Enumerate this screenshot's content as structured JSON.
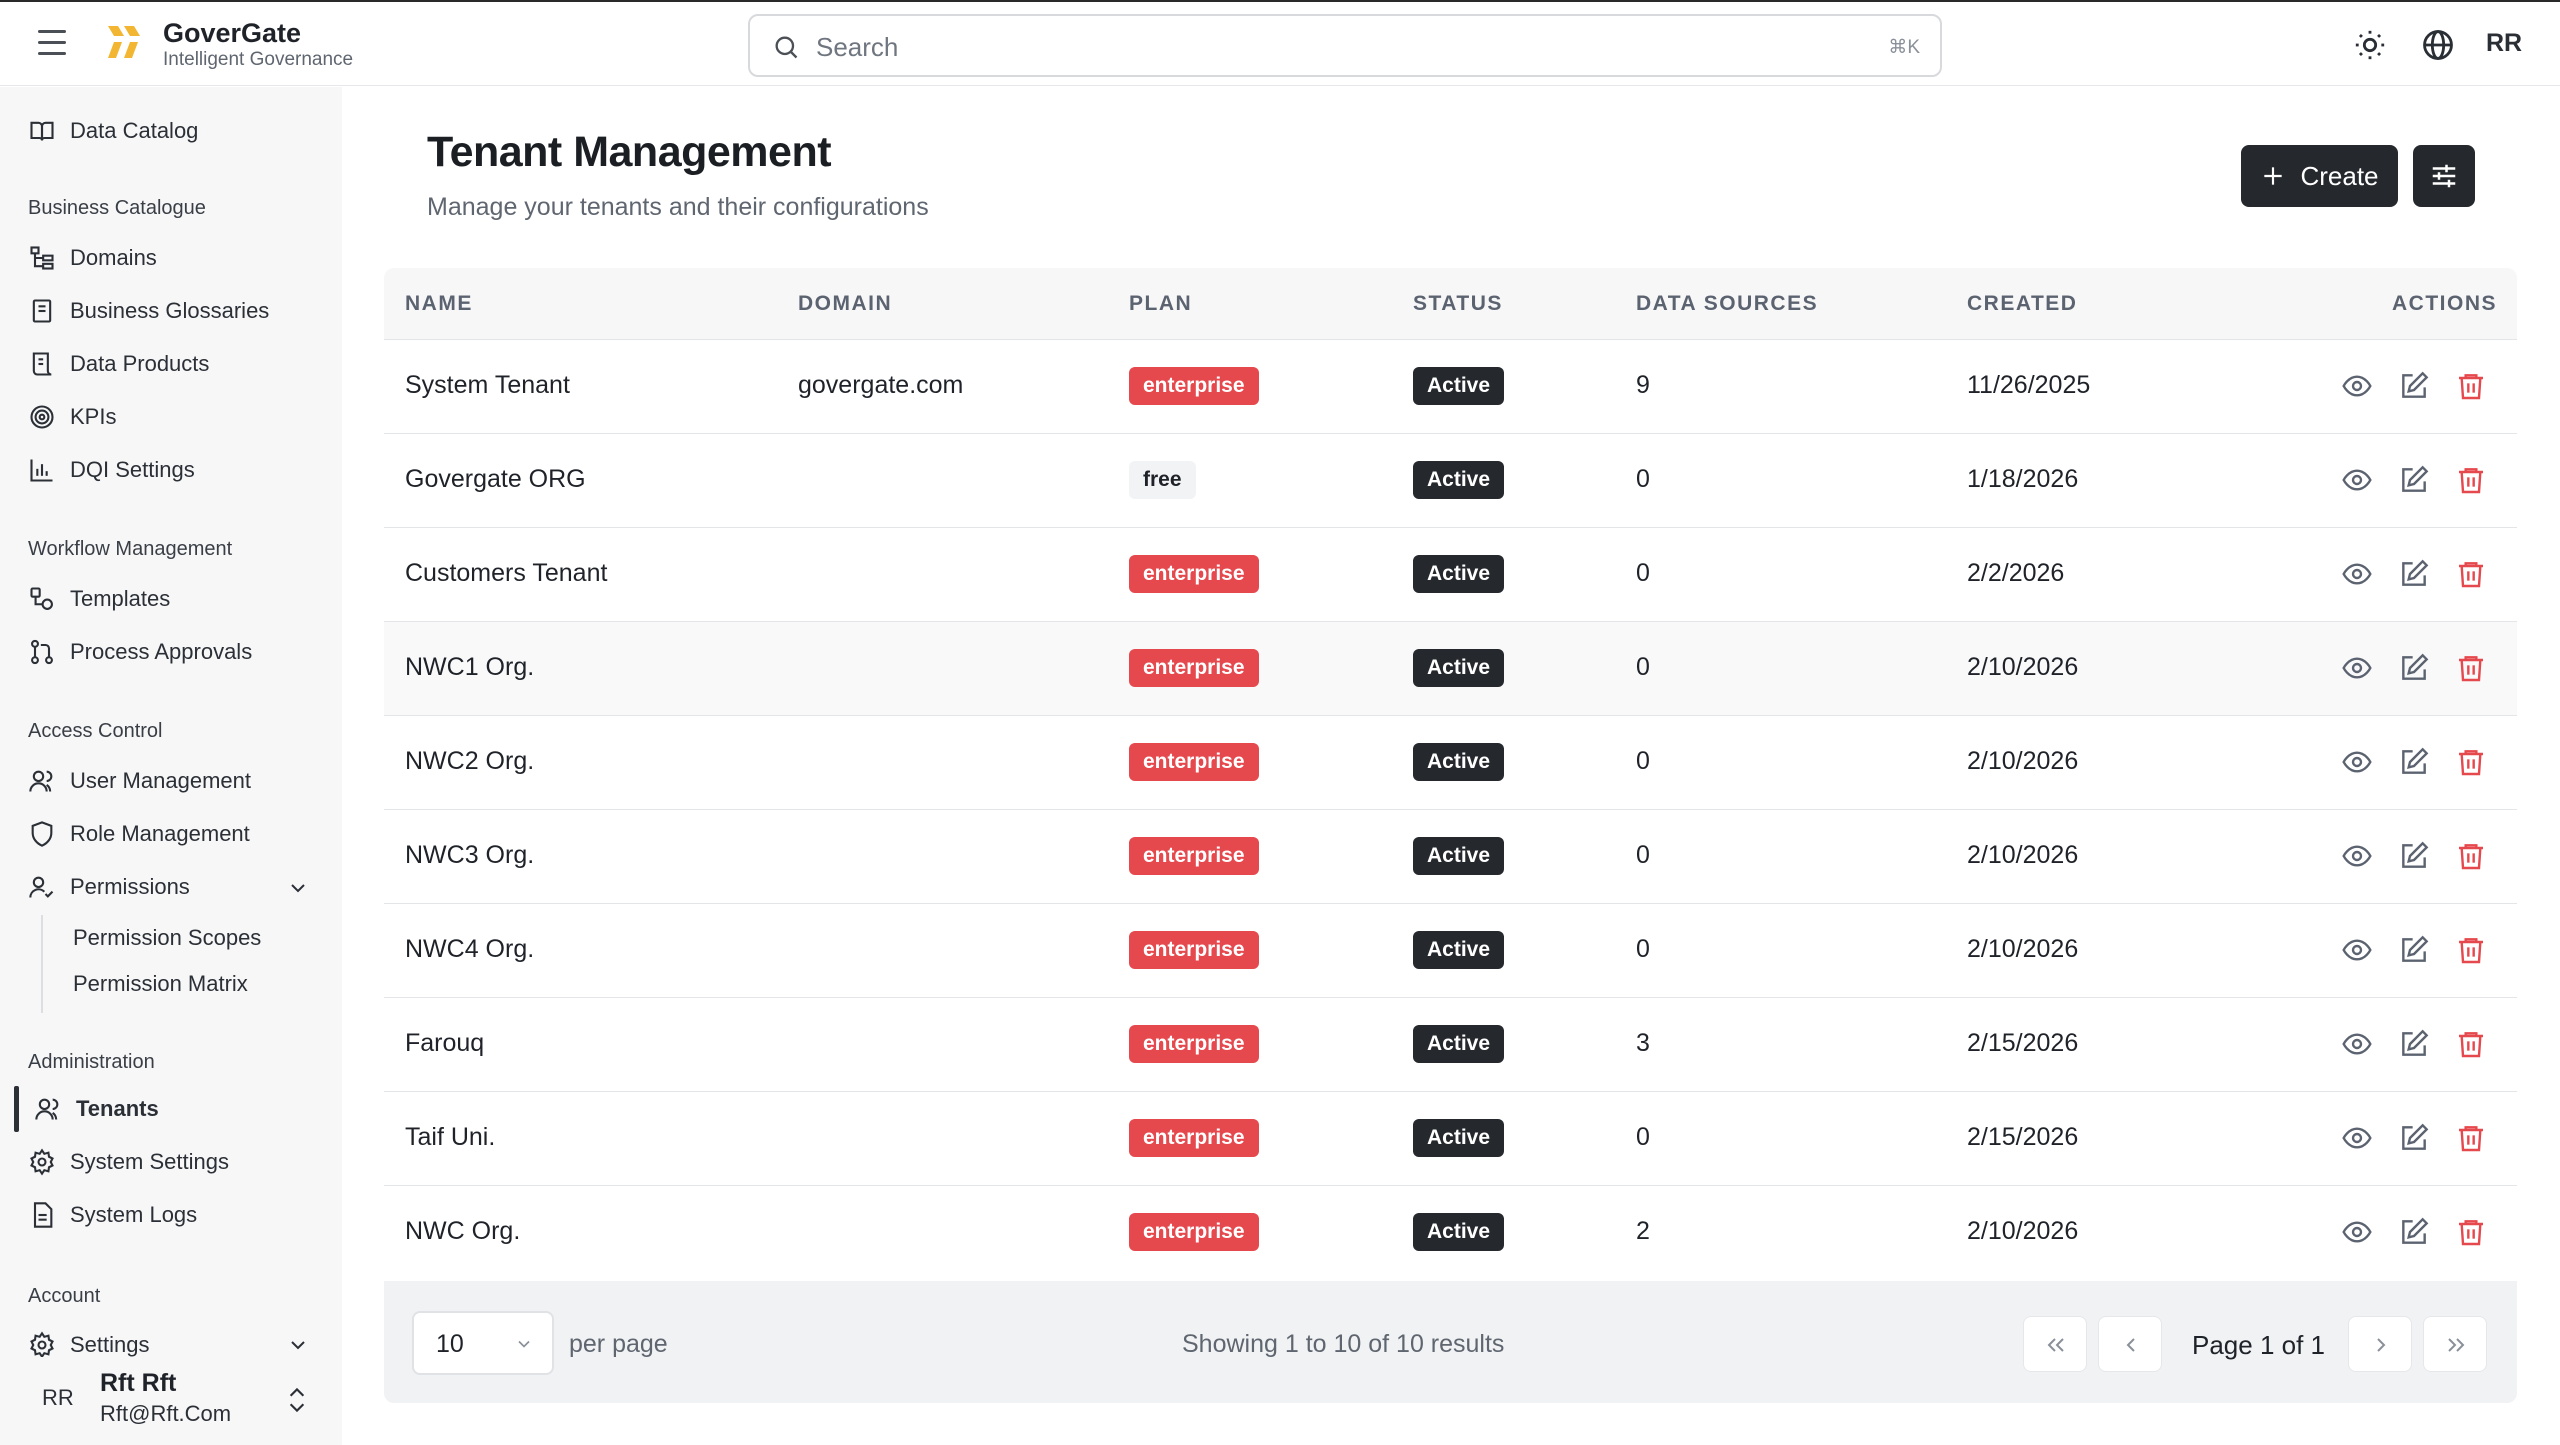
{
  "header": {
    "brand_name": "GoverGate",
    "brand_tagline": "Intelligent Governance",
    "search_placeholder": "Search",
    "search_shortcut": "⌘K",
    "user_initials": "RR"
  },
  "sidebar": {
    "top_item": "Data Catalog",
    "sections": [
      {
        "title": "Business Catalogue",
        "items": [
          "Domains",
          "Business Glossaries",
          "Data Products",
          "KPIs",
          "DQI Settings"
        ]
      },
      {
        "title": "Workflow Management",
        "items": [
          "Templates",
          "Process Approvals"
        ]
      },
      {
        "title": "Access Control",
        "items": [
          "User Management",
          "Role Management",
          "Permissions"
        ]
      },
      {
        "title": "Administration",
        "items": [
          "Tenants",
          "System Settings",
          "System Logs"
        ]
      },
      {
        "title": "Account",
        "items": [
          "Settings"
        ]
      }
    ],
    "permission_subitems": [
      "Permission Scopes",
      "Permission Matrix"
    ],
    "active_item": "Tenants",
    "user": {
      "initials": "RR",
      "name": "Rft Rft",
      "email": "Rft@Rft.Com"
    }
  },
  "page": {
    "title": "Tenant Management",
    "subtitle": "Manage your tenants and their configurations",
    "create_label": "Create"
  },
  "table": {
    "columns": [
      "NAME",
      "DOMAIN",
      "PLAN",
      "STATUS",
      "DATA SOURCES",
      "CREATED",
      "ACTIONS"
    ],
    "rows": [
      {
        "name": "System Tenant",
        "domain": "govergate.com",
        "plan": "enterprise",
        "status": "Active",
        "data_sources": "9",
        "created": "11/26/2025"
      },
      {
        "name": "Govergate ORG",
        "domain": "",
        "plan": "free",
        "status": "Active",
        "data_sources": "0",
        "created": "1/18/2026"
      },
      {
        "name": "Customers Tenant",
        "domain": "",
        "plan": "enterprise",
        "status": "Active",
        "data_sources": "0",
        "created": "2/2/2026"
      },
      {
        "name": "NWC1 Org.",
        "domain": "",
        "plan": "enterprise",
        "status": "Active",
        "data_sources": "0",
        "created": "2/10/2026"
      },
      {
        "name": "NWC2 Org.",
        "domain": "",
        "plan": "enterprise",
        "status": "Active",
        "data_sources": "0",
        "created": "2/10/2026"
      },
      {
        "name": "NWC3 Org.",
        "domain": "",
        "plan": "enterprise",
        "status": "Active",
        "data_sources": "0",
        "created": "2/10/2026"
      },
      {
        "name": "NWC4 Org.",
        "domain": "",
        "plan": "enterprise",
        "status": "Active",
        "data_sources": "0",
        "created": "2/10/2026"
      },
      {
        "name": "Farouq",
        "domain": "",
        "plan": "enterprise",
        "status": "Active",
        "data_sources": "3",
        "created": "2/15/2026"
      },
      {
        "name": "Taif Uni.",
        "domain": "",
        "plan": "enterprise",
        "status": "Active",
        "data_sources": "0",
        "created": "2/15/2026"
      },
      {
        "name": "NWC Org.",
        "domain": "",
        "plan": "enterprise",
        "status": "Active",
        "data_sources": "2",
        "created": "2/10/2026"
      }
    ]
  },
  "pagination": {
    "per_page_value": "10",
    "per_page_label": "per page",
    "showing": "Showing 1 to 10 of 10 results",
    "page_label": "Page 1 of 1"
  },
  "colors": {
    "enterprise_badge": "#e5484d",
    "status_badge": "#25282d",
    "delete_icon": "#e5484d",
    "logo": "#f2b632"
  }
}
